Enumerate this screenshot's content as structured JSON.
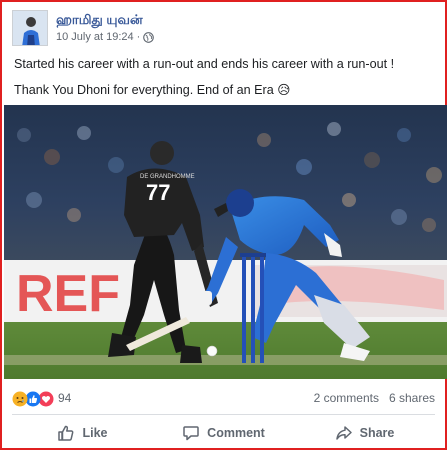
{
  "post": {
    "author": "ஹாமிது யுவன்",
    "timestamp": "10 July at 19:24",
    "separator": "·",
    "privacy_icon": "globe-icon",
    "paragraphs": [
      "Started his career with a run-out and ends his career with a run-out !",
      "Thank You Dhoni for everything. End of an Era 😥"
    ],
    "photo": {
      "jersey_number": "77",
      "jersey_name": "DE GRANDHOMME",
      "board_text": "REF"
    }
  },
  "engagement": {
    "reaction_icons": [
      "sad-icon",
      "like-icon",
      "love-icon"
    ],
    "reaction_count": "94",
    "comments": "2 comments",
    "shares": "6 shares"
  },
  "actions": {
    "like": "Like",
    "comment": "Comment",
    "share": "Share"
  },
  "colors": {
    "frame": "#e02020",
    "link": "#385898",
    "muted": "#606770",
    "like_blue": "#1877f2",
    "love_red": "#f33e58",
    "sad_yellow": "#f7b125"
  }
}
